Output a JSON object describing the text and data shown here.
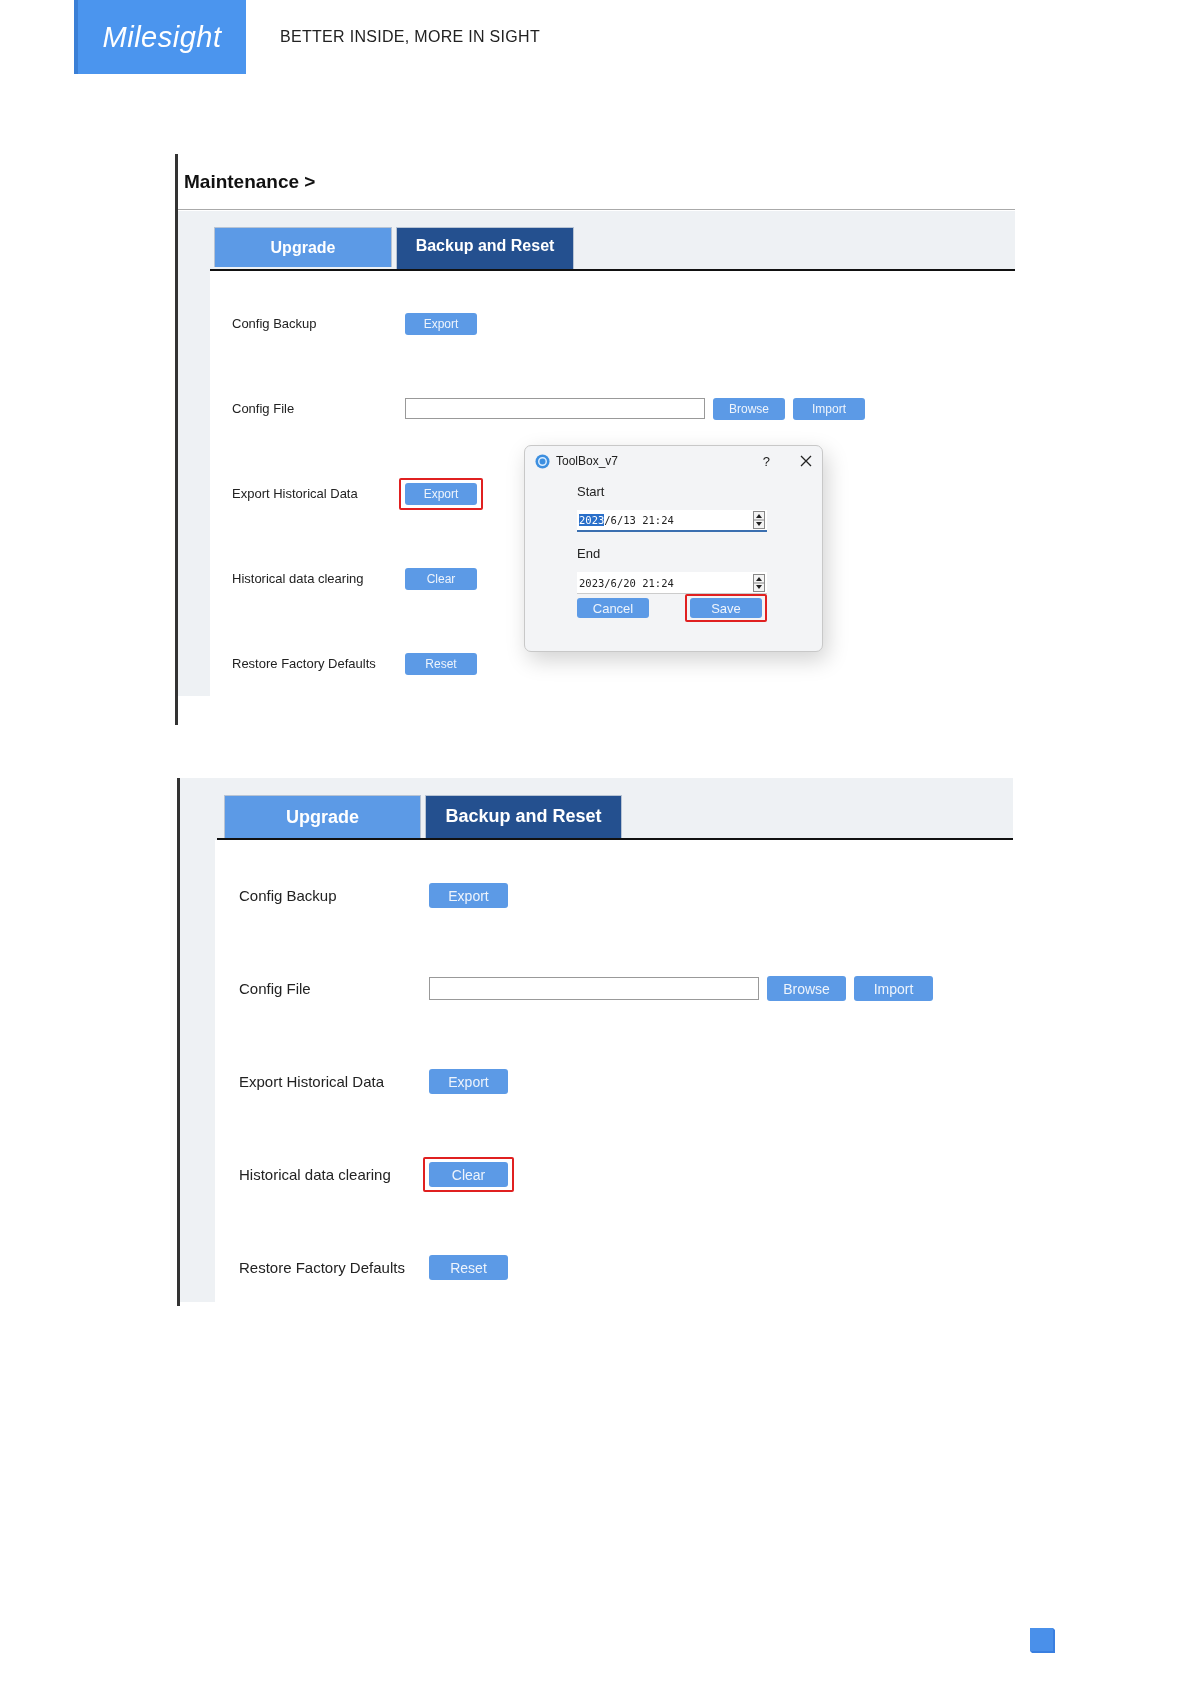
{
  "header": {
    "logo": "Milesight",
    "tagline": "BETTER INSIDE, MORE IN SIGHT"
  },
  "screenshots": [
    {
      "breadcrumb": "Maintenance >",
      "tabs": [
        {
          "label": "Upgrade",
          "selected": false
        },
        {
          "label": "Backup and Reset",
          "selected": true
        }
      ],
      "rows": [
        {
          "label": "Config Backup",
          "kind": "buttons",
          "buttons": [
            {
              "label": "Export",
              "highlighted": false
            }
          ]
        },
        {
          "label": "Config File",
          "kind": "file",
          "buttons": [
            {
              "label": "Browse",
              "highlighted": false
            },
            {
              "label": "Import",
              "highlighted": false
            }
          ]
        },
        {
          "label": "Export Historical Data",
          "kind": "buttons",
          "buttons": [
            {
              "label": "Export",
              "highlighted": true
            }
          ]
        },
        {
          "label": "Historical data clearing",
          "kind": "buttons",
          "buttons": [
            {
              "label": "Clear",
              "highlighted": false
            }
          ]
        },
        {
          "label": "Restore Factory Defaults",
          "kind": "buttons",
          "buttons": [
            {
              "label": "Reset",
              "highlighted": false
            }
          ]
        }
      ],
      "dialog": {
        "title": "ToolBox_v7",
        "help": "?",
        "fields": [
          {
            "label": "Start",
            "value": "2023/6/13 21:24",
            "focused": true
          },
          {
            "label": "End",
            "value": "2023/6/20 21:24",
            "focused": false
          }
        ],
        "buttons": [
          {
            "label": "Cancel",
            "highlighted": false
          },
          {
            "label": "Save",
            "highlighted": true
          }
        ]
      }
    },
    {
      "tabs": [
        {
          "label": "Upgrade",
          "selected": false
        },
        {
          "label": "Backup and Reset",
          "selected": true
        }
      ],
      "rows": [
        {
          "label": "Config Backup",
          "kind": "buttons",
          "buttons": [
            {
              "label": "Export",
              "highlighted": false
            }
          ]
        },
        {
          "label": "Config File",
          "kind": "file",
          "buttons": [
            {
              "label": "Browse",
              "highlighted": false
            },
            {
              "label": "Import",
              "highlighted": false
            }
          ]
        },
        {
          "label": "Export Historical Data",
          "kind": "buttons",
          "buttons": [
            {
              "label": "Export",
              "highlighted": false
            }
          ]
        },
        {
          "label": "Historical data clearing",
          "kind": "buttons",
          "buttons": [
            {
              "label": "Clear",
              "highlighted": true
            }
          ]
        },
        {
          "label": "Restore Factory Defaults",
          "kind": "buttons",
          "buttons": [
            {
              "label": "Reset",
              "highlighted": false
            }
          ]
        }
      ]
    }
  ]
}
